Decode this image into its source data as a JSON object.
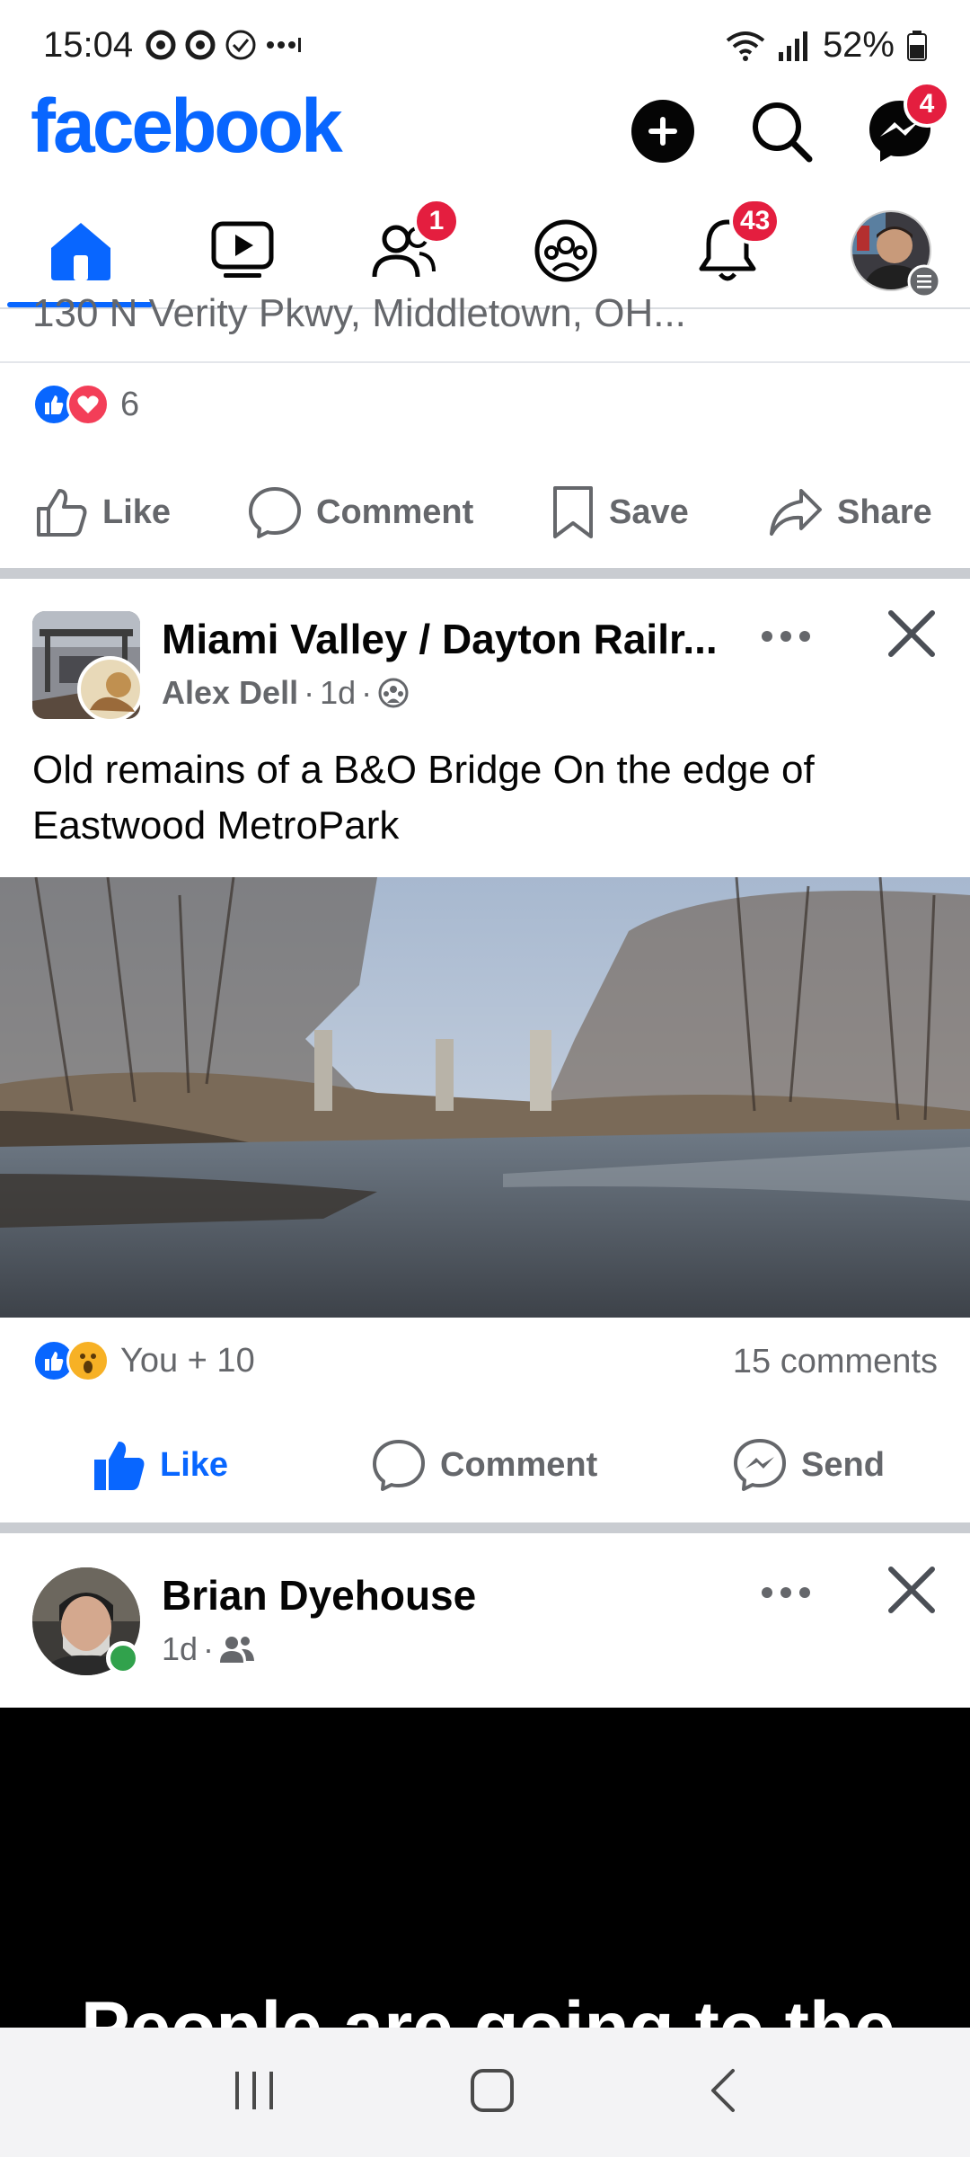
{
  "status": {
    "time": "15:04",
    "battery": "52%"
  },
  "header": {
    "logo": "facebook",
    "messenger_badge": "4",
    "icons": [
      "create-post-icon",
      "search-icon",
      "messenger-icon"
    ]
  },
  "tabs": {
    "friends_badge": "1",
    "notifications_badge": "43",
    "items": [
      "home",
      "video",
      "friends",
      "groups",
      "notifications",
      "profile-menu"
    ]
  },
  "prev_post": {
    "address": "130 N Verity Pkwy, Middletown, OH...",
    "reaction_count": "6",
    "actions": {
      "like": "Like",
      "comment": "Comment",
      "save": "Save",
      "share": "Share"
    }
  },
  "post1": {
    "group": "Miami Valley / Dayton Railr...",
    "author": "Alex Dell",
    "time": "1d",
    "text": "Old remains of a B&O Bridge On the edge of Eastwood MetroPark",
    "reactions": "You + 10",
    "comments": "15 comments",
    "actions": {
      "like": "Like",
      "comment": "Comment",
      "send": "Send"
    }
  },
  "post2": {
    "author": "Brian Dyehouse",
    "time": "1d",
    "video_caption": "People are going to the"
  },
  "colors": {
    "brand": "#0866ff",
    "badge": "#e41e3f",
    "secondary_text": "#65676b"
  }
}
